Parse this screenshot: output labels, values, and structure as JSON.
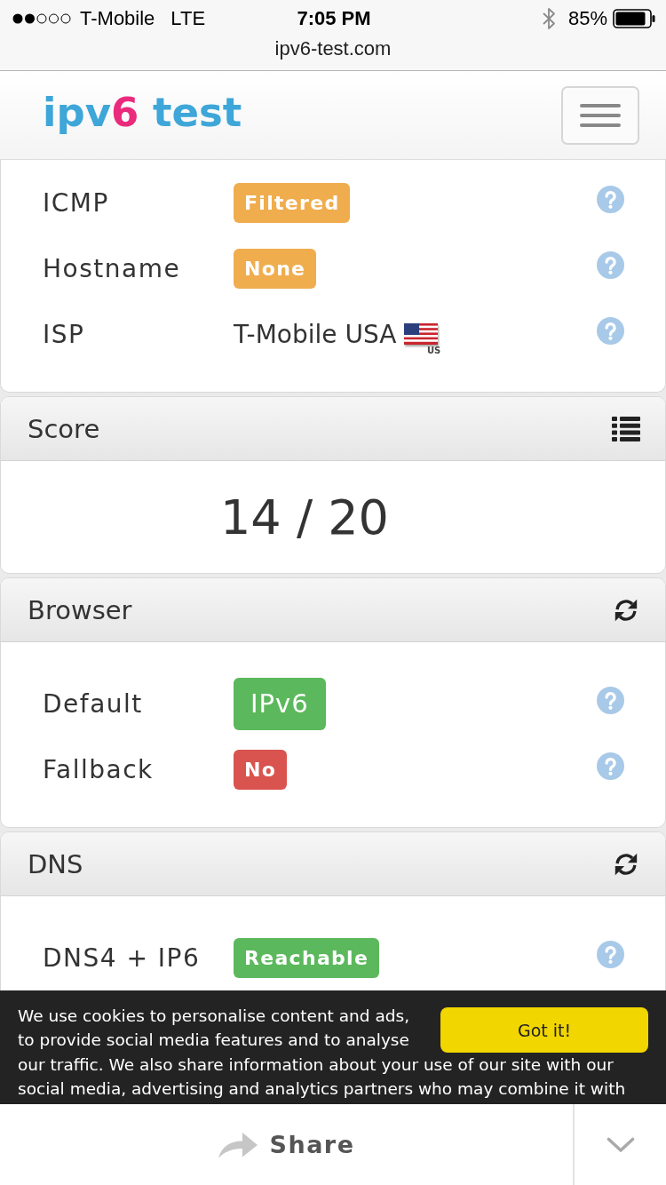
{
  "status_bar": {
    "carrier": "T-Mobile",
    "network": "LTE",
    "time": "7:05 PM",
    "battery": "85%"
  },
  "address_bar": {
    "url": "ipv6-test.com"
  },
  "navbar": {
    "logo": [
      {
        "text": "ipv",
        "accent": false
      },
      {
        "text": "6",
        "accent": true
      },
      {
        "text": " test",
        "accent": false
      }
    ]
  },
  "sections": [
    {
      "kind": "tests",
      "rows": [
        {
          "label": "ICMP",
          "kind": "badge",
          "value": "Filtered",
          "color": "#f0ad4e",
          "large": false
        },
        {
          "label": "Hostname",
          "kind": "badge",
          "value": "None",
          "color": "#f0ad4e",
          "large": false
        },
        {
          "label": "ISP",
          "kind": "text",
          "value": "T-Mobile USA",
          "flag_text": "US"
        }
      ]
    },
    {
      "kind": "score",
      "title": "Score",
      "score": "14 / 20"
    },
    {
      "kind": "tests",
      "title": "Browser",
      "rows": [
        {
          "label": "Default",
          "kind": "badge",
          "value": "IPv6",
          "color": "#5cb85c",
          "large": true
        },
        {
          "label": "Fallback",
          "kind": "badge",
          "value": "No",
          "color": "#d9534f",
          "large": false
        }
      ]
    },
    {
      "kind": "tests",
      "title": "DNS",
      "rows": [
        {
          "label": "DNS4 + IP6",
          "kind": "badge",
          "value": "Reachable",
          "color": "#5cb85c",
          "large": false
        }
      ]
    }
  ],
  "cookie_banner": {
    "text": [
      "We use cookies to personalise content and ads, to provide social media features and to analyse",
      "our traffic. We also share information about your use of our site with our social media, advertising and analytics partners who may combine it with"
    ],
    "button": "Got it!"
  },
  "share_bar": {
    "label": "Share"
  }
}
